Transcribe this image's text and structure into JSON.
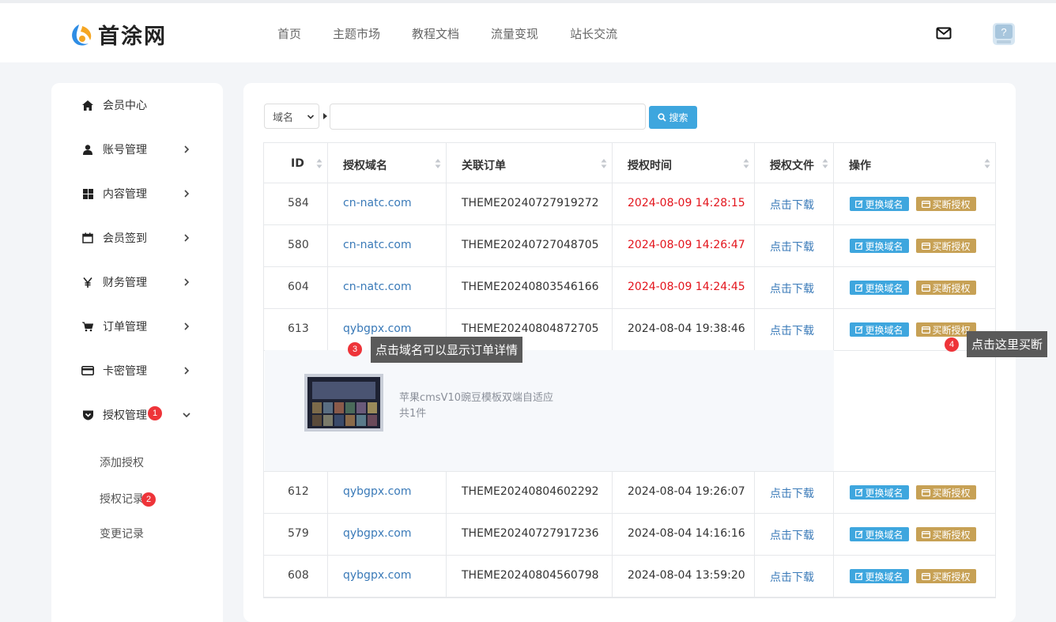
{
  "header": {
    "logo_text": "首涂网",
    "nav": [
      "首页",
      "主题市场",
      "教程文档",
      "流量变现",
      "站长交流"
    ]
  },
  "sidebar": {
    "items": [
      {
        "label": "会员中心",
        "icon": "home-icon"
      },
      {
        "label": "账号管理",
        "icon": "user-icon"
      },
      {
        "label": "内容管理",
        "icon": "grid-icon"
      },
      {
        "label": "会员签到",
        "icon": "calendar-icon"
      },
      {
        "label": "财务管理",
        "icon": "yen-icon"
      },
      {
        "label": "订单管理",
        "icon": "cart-icon"
      },
      {
        "label": "卡密管理",
        "icon": "credit-card-icon"
      },
      {
        "label": "授权管理",
        "icon": "shield-icon",
        "badge": "1"
      }
    ],
    "subitems": [
      {
        "label": "添加授权"
      },
      {
        "label": "授权记录",
        "badge": "2"
      },
      {
        "label": "变更记录"
      }
    ]
  },
  "search": {
    "select_value": "域名",
    "input_value": "",
    "button_label": "搜索"
  },
  "table": {
    "headers": [
      "ID",
      "授权域名",
      "关联订单",
      "授权时间",
      "授权文件",
      "操作"
    ],
    "rows": [
      {
        "id": "584",
        "domain": "cn-natc.com",
        "order": "THEME20240727919272",
        "time": "2024-08-09 14:28:15",
        "time_highlight": true,
        "file": "点击下载"
      },
      {
        "id": "580",
        "domain": "cn-natc.com",
        "order": "THEME20240727048705",
        "time": "2024-08-09 14:26:47",
        "time_highlight": true,
        "file": "点击下载"
      },
      {
        "id": "604",
        "domain": "cn-natc.com",
        "order": "THEME20240803546166",
        "time": "2024-08-09 14:24:45",
        "time_highlight": true,
        "file": "点击下载"
      },
      {
        "id": "613",
        "domain": "qybgpx.com",
        "order": "THEME20240804872705",
        "time": "2024-08-04 19:38:46",
        "time_highlight": false,
        "file": "点击下载"
      },
      {
        "id": "612",
        "domain": "qybgpx.com",
        "order": "THEME20240804602292",
        "time": "2024-08-04 19:26:07",
        "time_highlight": false,
        "file": "点击下载"
      },
      {
        "id": "579",
        "domain": "qybgpx.com",
        "order": "THEME20240727917236",
        "time": "2024-08-04 14:16:16",
        "time_highlight": false,
        "file": "点击下载"
      },
      {
        "id": "608",
        "domain": "qybgpx.com",
        "order": "THEME20240804560798",
        "time": "2024-08-04 13:59:20",
        "time_highlight": false,
        "file": "点击下载"
      }
    ],
    "actions": {
      "change_domain": "更换域名",
      "buyout": "买断授权"
    },
    "detail": {
      "product_title": "苹果cmsV10豌豆模板双端自适应",
      "product_count": "共1件"
    }
  },
  "tooltips": [
    {
      "badge": "3",
      "text": "点击域名可以显示订单详情"
    },
    {
      "badge": "4",
      "text": "点击这里买断"
    }
  ],
  "colors": {
    "accent_blue": "#3ea6de",
    "accent_gold": "#c7a155",
    "link_blue": "#3a7ab8",
    "highlight_red": "#e3141c",
    "badge_red": "#ee3439"
  }
}
